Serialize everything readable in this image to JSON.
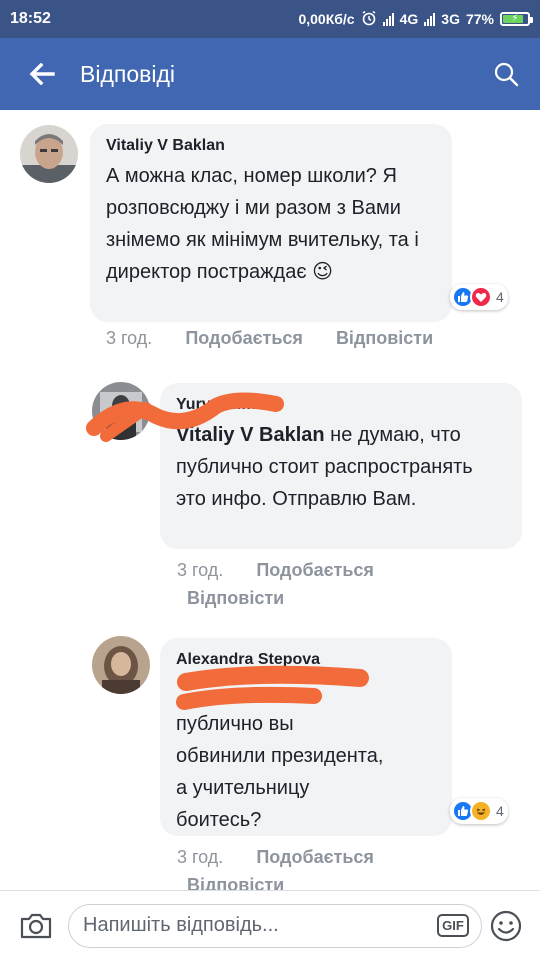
{
  "status_bar": {
    "time": "18:52",
    "net_speed": "0,00Кб/с",
    "net1": "4G",
    "net2": "3G",
    "battery_percent": "77%",
    "battery_level": 0.77
  },
  "header": {
    "title": "Відповіді",
    "back_icon": "arrow-left-icon",
    "search_icon": "search-icon"
  },
  "comments": [
    {
      "author": "Vitaliy V Baklan",
      "text": "А можна клас, номер школи? Я розповсюджу і ми разом з Вами знімемо як мінімум вчительку, та і директор постраждає",
      "emoji": "😉",
      "time": "3 год.",
      "like_label": "Подобається",
      "reply_label": "Відповісти",
      "reactions": [
        "like",
        "love"
      ],
      "reaction_count": "4"
    },
    {
      "author": "Yury Ch",
      "author_tail": "man",
      "mention": "Vitaliy V Baklan",
      "text": "не думаю, что публично стоит распространять это инфо. Отправлю Вам.",
      "time": "3 год.",
      "like_label": "Подобається",
      "reply_label": "Відповісти"
    },
    {
      "author": "Alexandra Stepova",
      "text_line1": "публично вы",
      "text_line2": "обвинили президента,",
      "text_line3": "а учительницу",
      "text_line4": "боитесь?",
      "time": "3 год.",
      "like_label": "Подобається",
      "reply_label": "Відповісти",
      "reactions": [
        "like",
        "haha"
      ],
      "reaction_count": "4"
    }
  ],
  "composer": {
    "placeholder": "Напишіть відповідь...",
    "gif_label": "GIF",
    "camera_icon": "camera-icon",
    "emoji_icon": "smiley-icon"
  },
  "colors": {
    "status_bar": "#3a5488",
    "app_bar": "#4267b2",
    "bubble": "#f2f3f5",
    "redaction": "#f26b3a"
  }
}
